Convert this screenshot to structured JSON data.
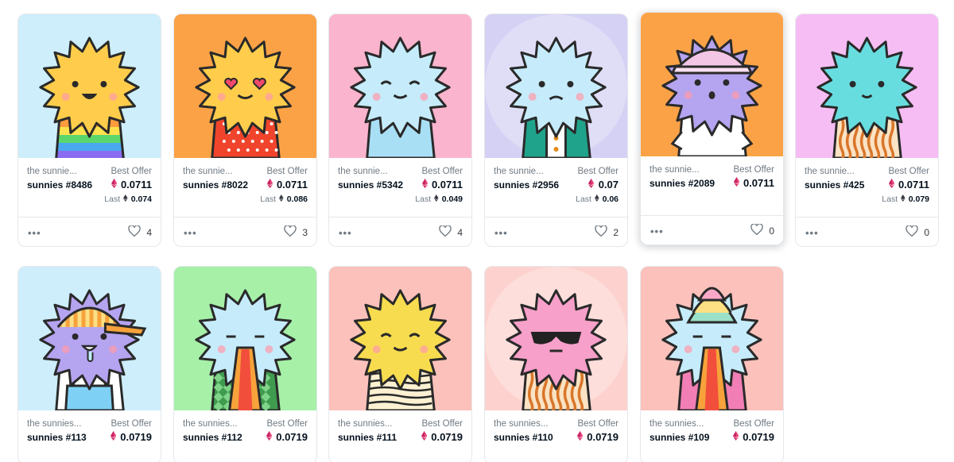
{
  "ui": {
    "best_offer_label": "Best Offer",
    "last_label": "Last",
    "more_glyph": "•••",
    "icons": {
      "price": "ethereum-icon",
      "likes": "heart-icon",
      "more": "more-options-icon"
    },
    "colors": {
      "eth_primary": "#e8467c",
      "eth_secondary": "#c41f60",
      "eth_dark": "#04111d",
      "muted_text": "#707a83",
      "border": "#e5e8eb"
    }
  },
  "cards": [
    {
      "collection": "the sunnie...",
      "name": "sunnies #8486",
      "price": "0.0711",
      "last_price": "0.074",
      "likes": "4",
      "art": {
        "bg": "#cdeefa",
        "face": "#ffcd4b",
        "outline": "#2a2a2a",
        "expression": "smile-open",
        "outfit": "rainbow-sweater",
        "hat": "none"
      }
    },
    {
      "collection": "the sunnie...",
      "name": "sunnies #8022",
      "price": "0.0711",
      "last_price": "0.086",
      "likes": "3",
      "art": {
        "bg": "#fca246",
        "face": "#ffcd4b",
        "outline": "#2a2a2a",
        "expression": "heart-eyes",
        "outfit": "red-polka-dot-shirt",
        "hat": "none"
      }
    },
    {
      "collection": "the sunnie...",
      "name": "sunnies #5342",
      "price": "0.0711",
      "last_price": "0.049",
      "likes": "4",
      "art": {
        "bg": "#fbb4cd",
        "face": "#c6ecfb",
        "outline": "#2a2a2a",
        "expression": "happy-closed-eyes",
        "outfit": "blue-shirt",
        "hat": "none"
      }
    },
    {
      "collection": "the sunnie...",
      "name": "sunnies #2956",
      "price": "0.07",
      "last_price": "0.06",
      "likes": "2",
      "art": {
        "bg": "#c4c0f0",
        "face": "#c6ecfb",
        "outline": "#2a2a2a",
        "expression": "frown",
        "outfit": "teal-jacket",
        "hat": "none"
      }
    },
    {
      "collection": "the sunnie...",
      "name": "sunnies #2089",
      "price": "0.0711",
      "last_price": "",
      "likes": "0",
      "art": {
        "bg": "#fca246",
        "face": "#b5a4f0",
        "outline": "#2a2a2a",
        "expression": "surprised",
        "outfit": "white-shirt",
        "hat": "pink-cap"
      }
    },
    {
      "collection": "the sunnie...",
      "name": "sunnies #425",
      "price": "0.0711",
      "last_price": "0.079",
      "likes": "0",
      "art": {
        "bg": "#f6bdf4",
        "face": "#68dde0",
        "outline": "#2a2a2a",
        "expression": "small-smile",
        "outfit": "orange-striped-shirt",
        "hat": "none"
      }
    },
    {
      "collection": "the sunnies...",
      "name": "sunnies #113",
      "price": "0.0719",
      "last_price": "",
      "likes": "",
      "art": {
        "bg": "#cdeefa",
        "face": "#b5a4f0",
        "outline": "#2a2a2a",
        "expression": "drool",
        "outfit": "overalls",
        "hat": "striped-cap"
      }
    },
    {
      "collection": "the sunnies...",
      "name": "sunnies #112",
      "price": "0.0719",
      "last_price": "",
      "likes": "",
      "art": {
        "bg": "#a6f0a8",
        "face": "#c6ecfb",
        "outline": "#2a2a2a",
        "expression": "rainbow-breath",
        "outfit": "green-argyle-sweater",
        "hat": "none"
      }
    },
    {
      "collection": "the sunnies...",
      "name": "sunnies #111",
      "price": "0.0719",
      "last_price": "",
      "likes": "",
      "art": {
        "bg": "#fcc1bb",
        "face": "#f8dc50",
        "outline": "#2a2a2a",
        "expression": "content",
        "outfit": "striped-sweater",
        "hat": "none"
      }
    },
    {
      "collection": "the sunnies...",
      "name": "sunnies #110",
      "price": "0.0719",
      "last_price": "",
      "likes": "",
      "art": {
        "bg": "#fcc1bb",
        "face": "#f7a0c9",
        "outline": "#2a2a2a",
        "expression": "sunglasses",
        "outfit": "orange-striped-shirt",
        "hat": "none"
      }
    },
    {
      "collection": "the sunnies...",
      "name": "sunnies #109",
      "price": "0.0719",
      "last_price": "",
      "likes": "",
      "art": {
        "bg": "#fcc1bb",
        "face": "#c6ecfb",
        "outline": "#2a2a2a",
        "expression": "rainbow-breath",
        "outfit": "pink-shirt",
        "hat": "ice-cream-swirl"
      }
    }
  ]
}
